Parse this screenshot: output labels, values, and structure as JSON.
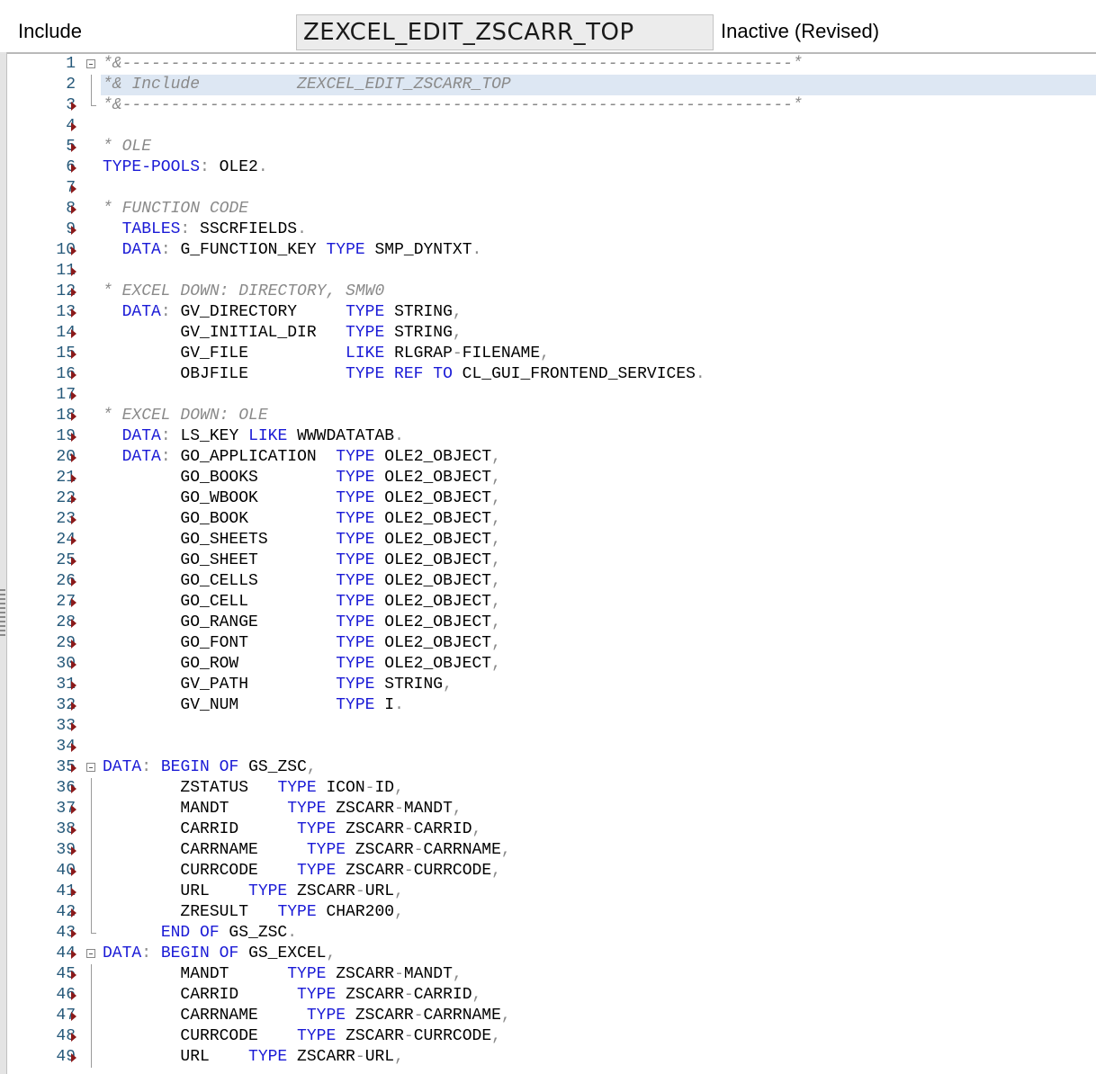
{
  "header": {
    "object_type_label": "Include",
    "object_name": "ZEXCEL_EDIT_ZSCARR_TOP",
    "status": "Inactive (Revised)"
  },
  "colors": {
    "keyword": "#1a1ad6",
    "comment": "#8a8a8a",
    "line_number": "#26597a",
    "current_line_highlight": "#dde7f3",
    "breakpoint_arrow": "#8b1a1a"
  },
  "code_lines": [
    {
      "n": "1",
      "marker": "fold",
      "tokens": [
        [
          "c",
          "*&---------------------------------------------------------------------*"
        ]
      ]
    },
    {
      "n": "2",
      "marker": "line",
      "highlight": true,
      "tokens": [
        [
          "c",
          "*& Include          ZEXCEL_EDIT_ZSCARR_TOP"
        ]
      ]
    },
    {
      "n": "3",
      "marker": "end",
      "tokens": [
        [
          "c",
          "*&---------------------------------------------------------------------*"
        ]
      ]
    },
    {
      "n": "4",
      "tokens": []
    },
    {
      "n": "5",
      "tokens": [
        [
          "c",
          "* OLE"
        ]
      ]
    },
    {
      "n": "6",
      "tokens": [
        [
          "k",
          "TYPE-POOLS"
        ],
        [
          "p",
          ":"
        ],
        [
          "n",
          " OLE2"
        ],
        [
          "p",
          "."
        ]
      ]
    },
    {
      "n": "7",
      "tokens": []
    },
    {
      "n": "8",
      "tokens": [
        [
          "c",
          "* FUNCTION CODE"
        ]
      ]
    },
    {
      "n": "9",
      "tokens": [
        [
          "n",
          "  "
        ],
        [
          "k",
          "TABLES"
        ],
        [
          "p",
          ":"
        ],
        [
          "n",
          " SSCRFIELDS"
        ],
        [
          "p",
          "."
        ]
      ]
    },
    {
      "n": "10",
      "tokens": [
        [
          "n",
          "  "
        ],
        [
          "k",
          "DATA"
        ],
        [
          "p",
          ":"
        ],
        [
          "n",
          " G_FUNCTION_KEY "
        ],
        [
          "k",
          "TYPE"
        ],
        [
          "n",
          " SMP_DYNTXT"
        ],
        [
          "p",
          "."
        ]
      ]
    },
    {
      "n": "11",
      "tokens": []
    },
    {
      "n": "12",
      "tokens": [
        [
          "c",
          "* EXCEL DOWN: DIRECTORY, SMW0"
        ]
      ]
    },
    {
      "n": "13",
      "tokens": [
        [
          "n",
          "  "
        ],
        [
          "k",
          "DATA"
        ],
        [
          "p",
          ":"
        ],
        [
          "n",
          " GV_DIRECTORY     "
        ],
        [
          "k",
          "TYPE"
        ],
        [
          "n",
          " STRING"
        ],
        [
          "p",
          ","
        ]
      ]
    },
    {
      "n": "14",
      "tokens": [
        [
          "n",
          "        GV_INITIAL_DIR   "
        ],
        [
          "k",
          "TYPE"
        ],
        [
          "n",
          " STRING"
        ],
        [
          "p",
          ","
        ]
      ]
    },
    {
      "n": "15",
      "tokens": [
        [
          "n",
          "        GV_FILE          "
        ],
        [
          "k",
          "LIKE"
        ],
        [
          "n",
          " RLGRAP"
        ],
        [
          "p",
          "-"
        ],
        [
          "n",
          "FILENAME"
        ],
        [
          "p",
          ","
        ]
      ]
    },
    {
      "n": "16",
      "tokens": [
        [
          "n",
          "        OBJFILE          "
        ],
        [
          "k",
          "TYPE REF TO"
        ],
        [
          "n",
          " CL_GUI_FRONTEND_SERVICES"
        ],
        [
          "p",
          "."
        ]
      ]
    },
    {
      "n": "17",
      "tokens": []
    },
    {
      "n": "18",
      "tokens": [
        [
          "c",
          "* EXCEL DOWN: OLE"
        ]
      ]
    },
    {
      "n": "19",
      "tokens": [
        [
          "n",
          "  "
        ],
        [
          "k",
          "DATA"
        ],
        [
          "p",
          ":"
        ],
        [
          "n",
          " LS_KEY "
        ],
        [
          "k",
          "LIKE"
        ],
        [
          "n",
          " WWWDATATAB"
        ],
        [
          "p",
          "."
        ]
      ]
    },
    {
      "n": "20",
      "tokens": [
        [
          "n",
          "  "
        ],
        [
          "k",
          "DATA"
        ],
        [
          "p",
          ":"
        ],
        [
          "n",
          " GO_APPLICATION  "
        ],
        [
          "k",
          "TYPE"
        ],
        [
          "n",
          " OLE2_OBJECT"
        ],
        [
          "p",
          ","
        ]
      ]
    },
    {
      "n": "21",
      "tokens": [
        [
          "n",
          "        GO_BOOKS        "
        ],
        [
          "k",
          "TYPE"
        ],
        [
          "n",
          " OLE2_OBJECT"
        ],
        [
          "p",
          ","
        ]
      ]
    },
    {
      "n": "22",
      "tokens": [
        [
          "n",
          "        GO_WBOOK        "
        ],
        [
          "k",
          "TYPE"
        ],
        [
          "n",
          " OLE2_OBJECT"
        ],
        [
          "p",
          ","
        ]
      ]
    },
    {
      "n": "23",
      "tokens": [
        [
          "n",
          "        GO_BOOK         "
        ],
        [
          "k",
          "TYPE"
        ],
        [
          "n",
          " OLE2_OBJECT"
        ],
        [
          "p",
          ","
        ]
      ]
    },
    {
      "n": "24",
      "tokens": [
        [
          "n",
          "        GO_SHEETS       "
        ],
        [
          "k",
          "TYPE"
        ],
        [
          "n",
          " OLE2_OBJECT"
        ],
        [
          "p",
          ","
        ]
      ]
    },
    {
      "n": "25",
      "tokens": [
        [
          "n",
          "        GO_SHEET        "
        ],
        [
          "k",
          "TYPE"
        ],
        [
          "n",
          " OLE2_OBJECT"
        ],
        [
          "p",
          ","
        ]
      ]
    },
    {
      "n": "26",
      "tokens": [
        [
          "n",
          "        GO_CELLS        "
        ],
        [
          "k",
          "TYPE"
        ],
        [
          "n",
          " OLE2_OBJECT"
        ],
        [
          "p",
          ","
        ]
      ]
    },
    {
      "n": "27",
      "tokens": [
        [
          "n",
          "        GO_CELL         "
        ],
        [
          "k",
          "TYPE"
        ],
        [
          "n",
          " OLE2_OBJECT"
        ],
        [
          "p",
          ","
        ]
      ]
    },
    {
      "n": "28",
      "tokens": [
        [
          "n",
          "        GO_RANGE        "
        ],
        [
          "k",
          "TYPE"
        ],
        [
          "n",
          " OLE2_OBJECT"
        ],
        [
          "p",
          ","
        ]
      ]
    },
    {
      "n": "29",
      "tokens": [
        [
          "n",
          "        GO_FONT         "
        ],
        [
          "k",
          "TYPE"
        ],
        [
          "n",
          " OLE2_OBJECT"
        ],
        [
          "p",
          ","
        ]
      ]
    },
    {
      "n": "30",
      "tokens": [
        [
          "n",
          "        GO_ROW          "
        ],
        [
          "k",
          "TYPE"
        ],
        [
          "n",
          " OLE2_OBJECT"
        ],
        [
          "p",
          ","
        ]
      ]
    },
    {
      "n": "31",
      "tokens": [
        [
          "n",
          "        GV_PATH         "
        ],
        [
          "k",
          "TYPE"
        ],
        [
          "n",
          " STRING"
        ],
        [
          "p",
          ","
        ]
      ]
    },
    {
      "n": "32",
      "tokens": [
        [
          "n",
          "        GV_NUM          "
        ],
        [
          "k",
          "TYPE"
        ],
        [
          "n",
          " I"
        ],
        [
          "p",
          "."
        ]
      ]
    },
    {
      "n": "33",
      "tokens": []
    },
    {
      "n": "34",
      "tokens": []
    },
    {
      "n": "35",
      "marker": "fold",
      "tokens": [
        [
          "k",
          "DATA"
        ],
        [
          "p",
          ":"
        ],
        [
          "n",
          " "
        ],
        [
          "k",
          "BEGIN OF"
        ],
        [
          "n",
          " GS_ZSC"
        ],
        [
          "p",
          ","
        ]
      ]
    },
    {
      "n": "36",
      "marker": "line",
      "tokens": [
        [
          "n",
          "        ZSTATUS   "
        ],
        [
          "k",
          "TYPE"
        ],
        [
          "n",
          " ICON"
        ],
        [
          "p",
          "-"
        ],
        [
          "n",
          "ID"
        ],
        [
          "p",
          ","
        ]
      ]
    },
    {
      "n": "37",
      "marker": "line",
      "tokens": [
        [
          "n",
          "        MANDT      "
        ],
        [
          "k",
          "TYPE"
        ],
        [
          "n",
          " ZSCARR"
        ],
        [
          "p",
          "-"
        ],
        [
          "n",
          "MANDT"
        ],
        [
          "p",
          ","
        ]
      ]
    },
    {
      "n": "38",
      "marker": "line",
      "tokens": [
        [
          "n",
          "        CARRID      "
        ],
        [
          "k",
          "TYPE"
        ],
        [
          "n",
          " ZSCARR"
        ],
        [
          "p",
          "-"
        ],
        [
          "n",
          "CARRID"
        ],
        [
          "p",
          ","
        ]
      ]
    },
    {
      "n": "39",
      "marker": "line",
      "tokens": [
        [
          "n",
          "        CARRNAME     "
        ],
        [
          "k",
          "TYPE"
        ],
        [
          "n",
          " ZSCARR"
        ],
        [
          "p",
          "-"
        ],
        [
          "n",
          "CARRNAME"
        ],
        [
          "p",
          ","
        ]
      ]
    },
    {
      "n": "40",
      "marker": "line",
      "tokens": [
        [
          "n",
          "        CURRCODE    "
        ],
        [
          "k",
          "TYPE"
        ],
        [
          "n",
          " ZSCARR"
        ],
        [
          "p",
          "-"
        ],
        [
          "n",
          "CURRCODE"
        ],
        [
          "p",
          ","
        ]
      ]
    },
    {
      "n": "41",
      "marker": "line",
      "tokens": [
        [
          "n",
          "        URL    "
        ],
        [
          "k",
          "TYPE"
        ],
        [
          "n",
          " ZSCARR"
        ],
        [
          "p",
          "-"
        ],
        [
          "n",
          "URL"
        ],
        [
          "p",
          ","
        ]
      ]
    },
    {
      "n": "42",
      "marker": "line",
      "tokens": [
        [
          "n",
          "        ZRESULT   "
        ],
        [
          "k",
          "TYPE"
        ],
        [
          "n",
          " CHAR200"
        ],
        [
          "p",
          ","
        ]
      ]
    },
    {
      "n": "43",
      "marker": "end",
      "tokens": [
        [
          "n",
          "      "
        ],
        [
          "k",
          "END OF"
        ],
        [
          "n",
          " GS_ZSC"
        ],
        [
          "p",
          "."
        ]
      ]
    },
    {
      "n": "44",
      "marker": "fold",
      "tokens": [
        [
          "k",
          "DATA"
        ],
        [
          "p",
          ":"
        ],
        [
          "n",
          " "
        ],
        [
          "k",
          "BEGIN OF"
        ],
        [
          "n",
          " GS_EXCEL"
        ],
        [
          "p",
          ","
        ]
      ]
    },
    {
      "n": "45",
      "marker": "line",
      "tokens": [
        [
          "n",
          "        MANDT      "
        ],
        [
          "k",
          "TYPE"
        ],
        [
          "n",
          " ZSCARR"
        ],
        [
          "p",
          "-"
        ],
        [
          "n",
          "MANDT"
        ],
        [
          "p",
          ","
        ]
      ]
    },
    {
      "n": "46",
      "marker": "line",
      "tokens": [
        [
          "n",
          "        CARRID      "
        ],
        [
          "k",
          "TYPE"
        ],
        [
          "n",
          " ZSCARR"
        ],
        [
          "p",
          "-"
        ],
        [
          "n",
          "CARRID"
        ],
        [
          "p",
          ","
        ]
      ]
    },
    {
      "n": "47",
      "marker": "line",
      "tokens": [
        [
          "n",
          "        CARRNAME     "
        ],
        [
          "k",
          "TYPE"
        ],
        [
          "n",
          " ZSCARR"
        ],
        [
          "p",
          "-"
        ],
        [
          "n",
          "CARRNAME"
        ],
        [
          "p",
          ","
        ]
      ]
    },
    {
      "n": "48",
      "marker": "line",
      "tokens": [
        [
          "n",
          "        CURRCODE    "
        ],
        [
          "k",
          "TYPE"
        ],
        [
          "n",
          " ZSCARR"
        ],
        [
          "p",
          "-"
        ],
        [
          "n",
          "CURRCODE"
        ],
        [
          "p",
          ","
        ]
      ]
    },
    {
      "n": "49",
      "marker": "line",
      "tokens": [
        [
          "n",
          "        URL    "
        ],
        [
          "k",
          "TYPE"
        ],
        [
          "n",
          " ZSCARR"
        ],
        [
          "p",
          "-"
        ],
        [
          "n",
          "URL"
        ],
        [
          "p",
          ","
        ]
      ]
    }
  ]
}
